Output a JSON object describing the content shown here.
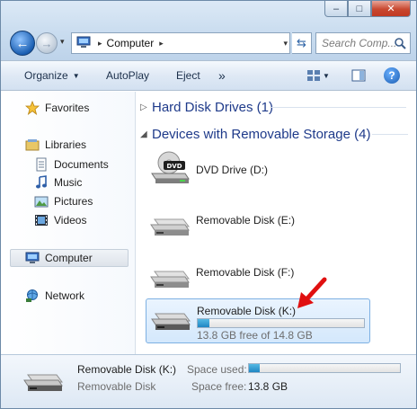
{
  "window": {
    "caption": {
      "minimize": "–",
      "maximize": "□",
      "close": "✕"
    }
  },
  "nav": {
    "back_glyph": "←",
    "forward_glyph": "→",
    "dropdown_glyph": "▾",
    "address": {
      "crumb": "Computer",
      "separator": "▸"
    },
    "refresh_glyph": "⇆",
    "search": {
      "placeholder": "Search Comp..."
    }
  },
  "toolbar": {
    "organize": "Organize",
    "autoplay": "AutoPlay",
    "eject": "Eject",
    "more": "»",
    "caret": "▼",
    "help": "?"
  },
  "sidebar": {
    "favorites": {
      "label": "Favorites",
      "icon": "star-icon"
    },
    "libraries": {
      "label": "Libraries",
      "icon": "libraries-icon",
      "items": [
        {
          "label": "Documents",
          "icon": "documents-icon"
        },
        {
          "label": "Music",
          "icon": "music-icon"
        },
        {
          "label": "Pictures",
          "icon": "pictures-icon"
        },
        {
          "label": "Videos",
          "icon": "videos-icon"
        }
      ]
    },
    "computer": {
      "label": "Computer",
      "icon": "computer-icon",
      "selected": true
    },
    "network": {
      "label": "Network",
      "icon": "network-icon"
    }
  },
  "main": {
    "groups": [
      {
        "title": "Hard Disk Drives (1)",
        "expanded": false,
        "glyph": "▷"
      },
      {
        "title": "Devices with Removable Storage (4)",
        "expanded": true,
        "glyph": "◢"
      }
    ],
    "drives": [
      {
        "name": "DVD Drive (D:)",
        "type": "dvd",
        "badge": "DVD"
      },
      {
        "name": "Removable Disk (E:)",
        "type": "removable"
      },
      {
        "name": "Removable Disk (F:)",
        "type": "removable"
      },
      {
        "name": "Removable Disk (K:)",
        "type": "removable",
        "selected": true,
        "free_text": "13.8 GB free of 14.8 GB",
        "used_fraction": 0.07
      }
    ]
  },
  "details": {
    "name": "Removable Disk (K:)",
    "type": "Removable Disk",
    "space_used_label": "Space used:",
    "space_free_label": "Space free:",
    "space_free_value": "13.8 GB",
    "used_fraction": 0.07
  },
  "colors": {
    "accent_blue": "#1e3a8a",
    "selection_fill": "#d4e8fc",
    "bar_fill": "#1f86c3",
    "annotation_red": "#e01010"
  }
}
